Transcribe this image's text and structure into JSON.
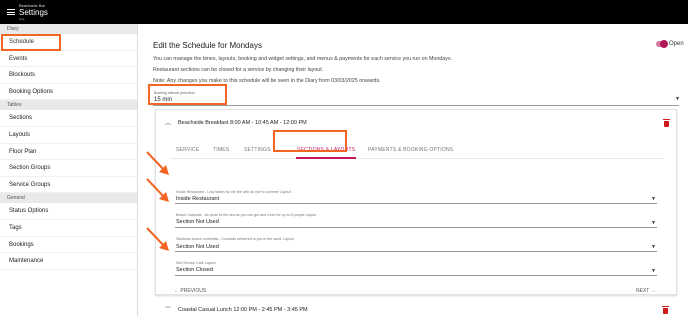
{
  "app": {
    "venue": "Beachside Bar",
    "title": "Settings",
    "subtitle": "Live"
  },
  "sidebar": {
    "sections": [
      {
        "header": "Diary",
        "items": [
          "Schedule",
          "Events",
          "Blockouts",
          "Booking Options"
        ]
      },
      {
        "header": "Tables",
        "items": [
          "Sections",
          "Layouts",
          "Floor Plan",
          "Section Groups",
          "Service Groups"
        ]
      },
      {
        "header": "General",
        "items": [
          "Status Options",
          "Tags",
          "Bookings",
          "Maintenance"
        ]
      }
    ]
  },
  "main": {
    "title": "Edit the Schedule for Mondays",
    "info": [
      "You can manage the times, layouts, booking and widget settings, and menus & payments for each service you run on Mondays.",
      "Restaurant sections can be closed for a service by changing their layout.",
      "Note: Any changes you make to this schedule will be seen in the Diary from 03/03/2025 onwards."
    ],
    "open_label": "Open",
    "interval": {
      "label": "Booking Interval (minutes)",
      "value": "15 min"
    }
  },
  "services": [
    {
      "title": "Beachside Breakfast 8:00 AM - 10:45 AM - 12:00 PM",
      "tabs": [
        "SERVICE",
        "TIMES",
        "SETTINGS",
        "SECTIONS & LAYOUTS",
        "PAYMENTS & BOOKING OPTIONS"
      ],
      "active_tab": "SECTIONS & LAYOUTS",
      "fields": [
        {
          "label": "Inside Restaurant - Lray tables by the fire with an eye to summer Layout",
          "value": "Inside Restaurant"
        },
        {
          "label": "Beach Cabanas - As close to the sea as you can get and room for up to 8 people Layout",
          "value": "Section Not Used"
        },
        {
          "label": "Sandown beach umbrellas - Cocktails delivered to you in the sand. Layout",
          "value": "Section Not Used"
        },
        {
          "label": "Self Service Cafe Layout",
          "value": "Section Closed"
        }
      ],
      "prev_label": "PREVIOUS",
      "next_label": "NEXT"
    },
    {
      "title": "Coastal Casual Lunch 12:00 PM - 2:45 PM - 3:45 PM"
    }
  ],
  "colors": {
    "accent": "#c2185b",
    "highlight": "#f26522",
    "delete": "#d01b1b",
    "topbar": "#000000"
  },
  "icons": [
    "menu-icon",
    "chevron-up-icon",
    "chevron-down-icon",
    "dropdown-caret-icon",
    "trash-icon",
    "arrow-left-icon",
    "arrow-right-icon",
    "annotation-arrow-icon"
  ]
}
